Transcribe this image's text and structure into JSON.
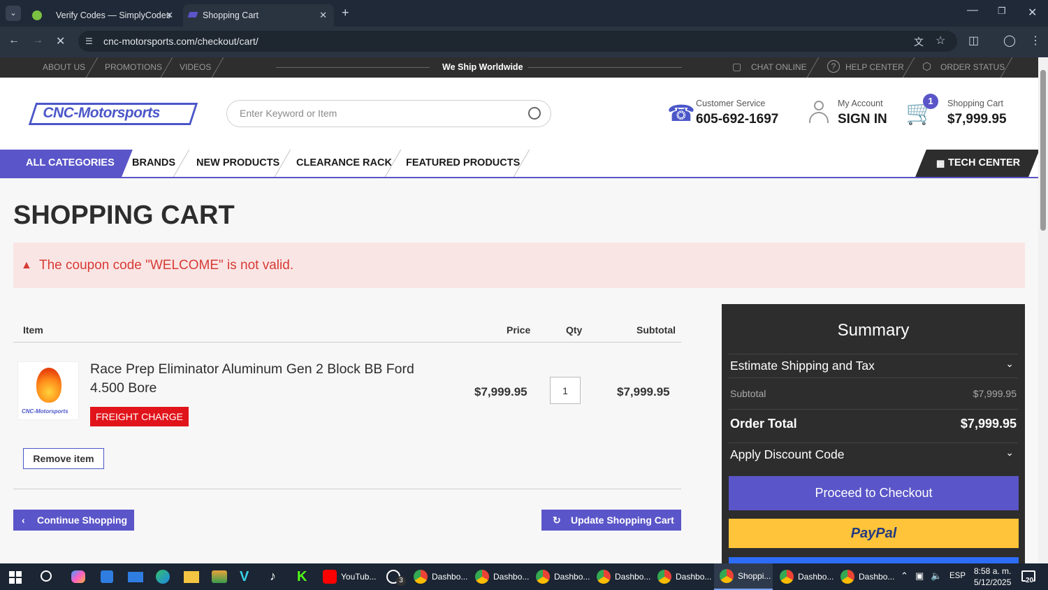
{
  "browser": {
    "tabs": [
      {
        "label": "Verify Codes — SimplyCodes"
      },
      {
        "label": "Shopping Cart"
      }
    ],
    "url": "cnc-motorsports.com/checkout/cart/"
  },
  "topbar": {
    "links": [
      "ABOUT US",
      "PROMOTIONS",
      "VIDEOS"
    ],
    "tagline": "We Ship Worldwide",
    "right_links": [
      "CHAT ONLINE",
      "HELP CENTER",
      "ORDER STATUS"
    ]
  },
  "header": {
    "logo": "CNC-Motorsports",
    "search_placeholder": "Enter Keyword or Item",
    "customer_service_label": "Customer Service",
    "phone": "605-692-1697",
    "account_label": "My Account",
    "account_action": "SIGN IN",
    "cart_label": "Shopping Cart",
    "cart_total": "$7,999.95",
    "cart_count": "1"
  },
  "nav": {
    "items": [
      "ALL CATEGORIES",
      "BRANDS",
      "NEW PRODUCTS",
      "CLEARANCE RACK",
      "FEATURED PRODUCTS"
    ],
    "tech_center": "TECH CENTER"
  },
  "page": {
    "title": "SHOPPING CART",
    "alert": "The coupon code \"WELCOME\" is not valid.",
    "columns": {
      "item": "Item",
      "price": "Price",
      "qty": "Qty",
      "subtotal": "Subtotal"
    },
    "cart_item": {
      "name": "Race Prep Eliminator Aluminum Gen 2 Block BB Ford 4.500 Bore",
      "badge": "FREIGHT CHARGE",
      "price": "$7,999.95",
      "qty": "1",
      "subtotal": "$7,999.95",
      "thumb_text": "CNC-Motorsports"
    },
    "remove_label": "Remove item",
    "continue_label": "Continue Shopping",
    "update_label": "Update Shopping Cart"
  },
  "summary": {
    "title": "Summary",
    "shipping_label": "Estimate Shipping and Tax",
    "subtotal_label": "Subtotal",
    "subtotal_value": "$7,999.95",
    "total_label": "Order Total",
    "total_value": "$7,999.95",
    "discount_label": "Apply Discount Code",
    "checkout_label": "Proceed to Checkout",
    "paypal_label": "PayPal"
  },
  "taskbar": {
    "apps": [
      "YouTub...",
      "Dashbo...",
      "Dashbo...",
      "Dashbo...",
      "Dashbo...",
      "Dashbo...",
      "Shoppi...",
      "Dashbo...",
      "Dashbo..."
    ],
    "lang": "ESP",
    "time": "8:58 a. m.",
    "date": "5/12/2025",
    "notif_count": "20",
    "whatsapp_badge": "3"
  },
  "colors": {
    "accent": "#5a55c8",
    "alert_text": "#d63b35",
    "alert_bg": "#fae5e5",
    "badge": "#e0141a",
    "summary_bg": "#2d2d2d",
    "paypal": "#ffc439"
  }
}
